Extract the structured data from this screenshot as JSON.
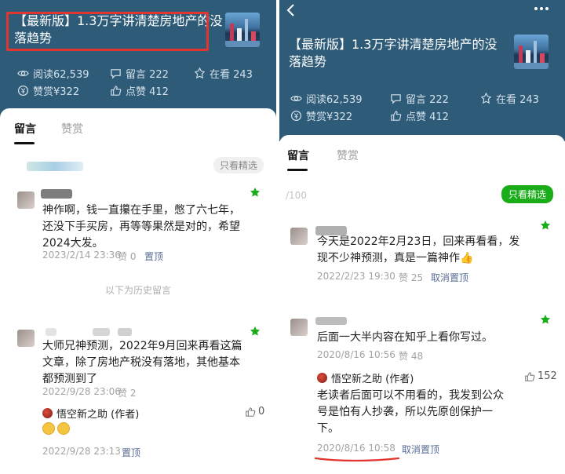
{
  "article": {
    "title_line1": "【最新版】1.3万字讲清楚房地产的没",
    "title_line2": "落趋势",
    "reads": "阅读62,539",
    "comments": "留言 222",
    "viewing": "在看 243",
    "reward": "赞赏¥322",
    "likes": "点赞 412"
  },
  "tabs": {
    "comments": "留言",
    "reward": "赞赏"
  },
  "left": {
    "filter_pill": "只看精选",
    "history_divider": "以下为历史留言",
    "comment1": {
      "text_line1": "神作啊，钱一直攥在手里，憋了六七年，",
      "text_line2": "还没下手买房，再等等果然是对的，希望",
      "text_line3": "2024大发。",
      "date": "2023/2/14 23:36",
      "likes": "赞 0",
      "action": "置顶"
    },
    "comment2": {
      "text_line1": "大师兄神预测，2022年9月回来再看这篇",
      "text_line2": "文章，除了房地产税没有落地，其他基本",
      "text_line3": "都预测到了",
      "date": "2022/9/28 23:06",
      "likes": "赞 2",
      "reply_author": "悟空新之助 (作者)",
      "reply_likes": "0",
      "reply_date": "2022/9/28 23:13",
      "reply_action": "置顶"
    }
  },
  "right": {
    "counter": "/100",
    "filter_pill": "只看精选",
    "comment1": {
      "text_line1": "今天是2022年2月23日，回来再看看，发",
      "text_line2": "现不少神预测，真是一篇神作👍",
      "date": "2022/2/23 19:30",
      "likes": "赞 25",
      "action": "取消置顶"
    },
    "comment2": {
      "text_line1": "后面一大半内容在知乎上看你写过。",
      "date": "2020/8/16 10:56",
      "likes": "赞 48",
      "reply_author": "悟空新之助 (作者)",
      "reply_likes": "152",
      "reply_line1": "老读者后面可以不用看的，我发到公众",
      "reply_line2": "号是怕有人抄袭，所以先原创保护一",
      "reply_line3": "下。",
      "reply_date": "2020/8/16 10:58",
      "reply_action": "取消置顶"
    }
  },
  "colors": {
    "header_bg": "#2d5b78",
    "highlight_red": "#e2352f",
    "link_blue": "#576b95",
    "star_green": "#1aad19"
  },
  "icons": [
    "eye-icon",
    "comment-icon",
    "viewing-icon",
    "reward-icon",
    "thumb-up-icon",
    "star-icon",
    "back-icon",
    "more-icon"
  ]
}
